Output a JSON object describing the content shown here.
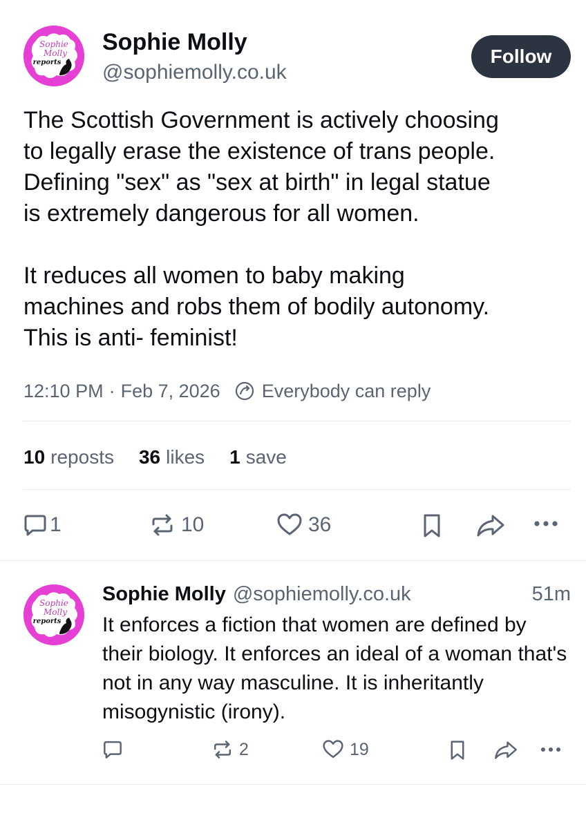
{
  "post": {
    "author_name": "Sophie Molly",
    "author_handle": "@sophiemolly.co.uk",
    "avatar_text": [
      "Sophie",
      "Molly",
      "reports"
    ],
    "follow_label": "Follow",
    "paragraphs": [
      "The Scottish Government is actively choosing\nto legally erase the existence of trans people.\nDefining \"sex\" as \"sex at birth\" in legal statue\nis extremely dangerous for all women.",
      "It reduces all women to baby making\nmachines and robs them of bodily autonomy.\nThis is anti- feminist!"
    ],
    "time": "12:10 PM",
    "date": "Feb 7, 2026",
    "reply_setting": "Everybody can reply",
    "stats": {
      "reposts_count": "10",
      "reposts_label": "reposts",
      "likes_count": "36",
      "likes_label": "likes",
      "saves_count": "1",
      "saves_label": "save"
    },
    "actions": {
      "reply_count": "1",
      "repost_count": "10",
      "like_count": "36"
    }
  },
  "reply": {
    "author_name": "Sophie Molly",
    "author_handle": "@sophiemolly.co.uk",
    "time_ago": "51m",
    "text": "It enforces a fiction that women are defined by their biology. It enforces an ideal of a woman that's not in any way masculine. It is inheritantly misogynistic (irony).",
    "actions": {
      "repost_count": "2",
      "like_count": "19"
    }
  },
  "colors": {
    "avatar_bg": "#e63fd3",
    "follow_bg": "#2b3440",
    "muted_text": "#5b6472",
    "icon_color": "#5b6472"
  },
  "icons": [
    "reply-icon",
    "repost-icon",
    "like-icon",
    "bookmark-icon",
    "share-icon",
    "more-icon",
    "reply-setting-icon"
  ]
}
